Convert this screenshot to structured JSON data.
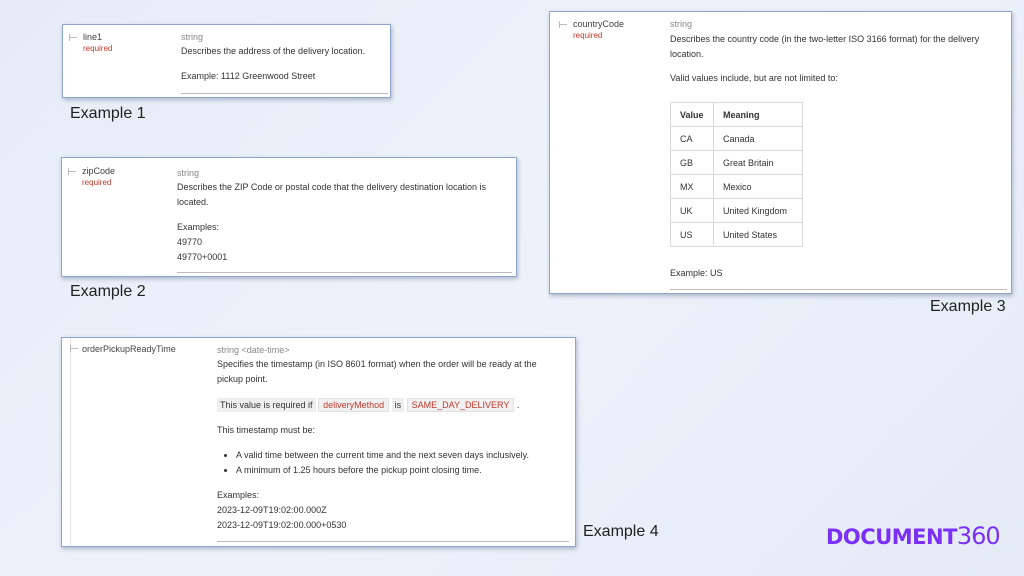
{
  "ex1": {
    "field": "line1",
    "required": "required",
    "type": "string",
    "description": "Describes the address of the delivery location.",
    "example": "Example: 1112 Greenwood Street",
    "caption": "Example 1"
  },
  "ex2": {
    "field": "zipCode",
    "required": "required",
    "type": "string",
    "description_l1": "Describes the ZIP Code or postal code that the delivery destination location is",
    "description_l2": "located.",
    "examples_label": "Examples:",
    "examples": [
      "49770",
      "49770+0001"
    ],
    "caption": "Example 2"
  },
  "ex3": {
    "field": "countryCode",
    "required": "required",
    "type": "string",
    "description_l1": "Describes the country code (in the two-letter ISO 3166 format) for the delivery",
    "description_l2": "location.",
    "valid_values": "Valid values include, but are not limited to:",
    "table_headers": [
      "Value",
      "Meaning"
    ],
    "table_rows": [
      [
        "CA",
        "Canada"
      ],
      [
        "GB",
        "Great Britain"
      ],
      [
        "MX",
        "Mexico"
      ],
      [
        "UK",
        "United Kingdom"
      ],
      [
        "US",
        "United States"
      ]
    ],
    "example": "Example: US",
    "caption": "Example 3"
  },
  "ex4": {
    "field": "orderPickupReadyTime",
    "type": "string <date-time>",
    "description_l1": "Specifies the timestamp (in ISO 8601 format) when the order will be ready at the",
    "description_l2": "pickup point.",
    "required_prefix": "This value is required if",
    "required_field": "deliveryMethod",
    "required_is": "is",
    "required_value": "SAME_DAY_DELIVERY",
    "required_end": ".",
    "must_be": "This timestamp must be:",
    "bullets": [
      "A valid time between the current time and the next seven days inclusively.",
      "A minimum of 1.25 hours before the pickup point closing time."
    ],
    "examples_label": "Examples:",
    "examples": [
      "2023-12-09T19:02:00.000Z",
      "2023-12-09T19:02:00.000+0530"
    ],
    "caption": "Example 4"
  },
  "logo": {
    "text": "DOCUMENT",
    "number": "360"
  },
  "colors": {
    "brand": "#7b2ff7",
    "required": "#c0392b"
  }
}
